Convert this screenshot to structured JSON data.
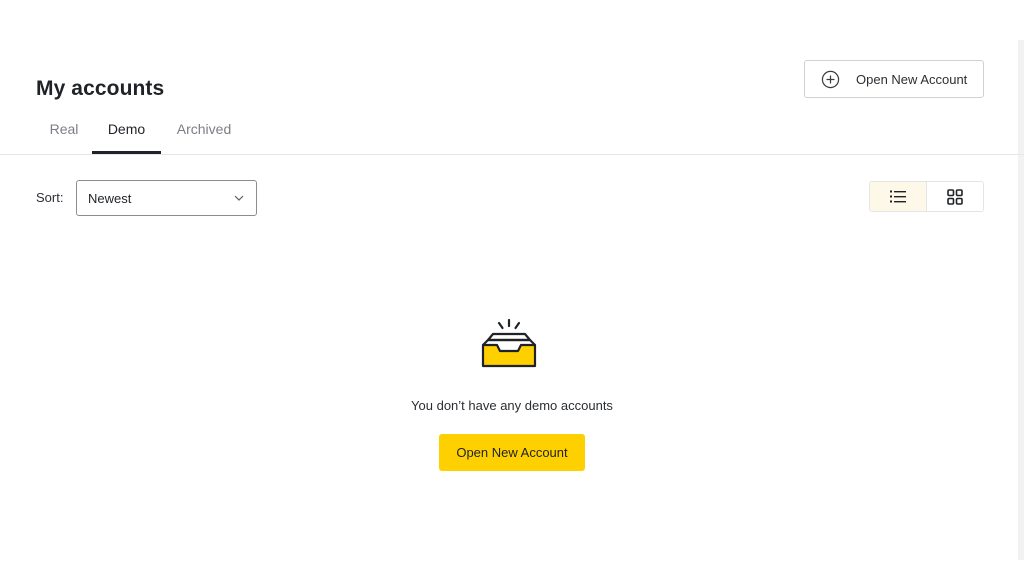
{
  "header": {
    "title": "My accounts",
    "open_account_label": "Open New Account"
  },
  "tabs": [
    {
      "label": "Real",
      "active": false
    },
    {
      "label": "Demo",
      "active": true
    },
    {
      "label": "Archived",
      "active": false
    }
  ],
  "toolbar": {
    "sort_label": "Sort:",
    "sort_value": "Newest",
    "view_modes": [
      "list",
      "grid"
    ],
    "active_view": "list"
  },
  "empty_state": {
    "message": "You don’t have any demo accounts",
    "cta_label": "Open New Account",
    "icon": "empty-inbox-icon"
  },
  "colors": {
    "accent": "#ffd000",
    "text": "#1f2327",
    "muted": "#7b7f84",
    "active_view_bg": "#fdf8e7"
  }
}
